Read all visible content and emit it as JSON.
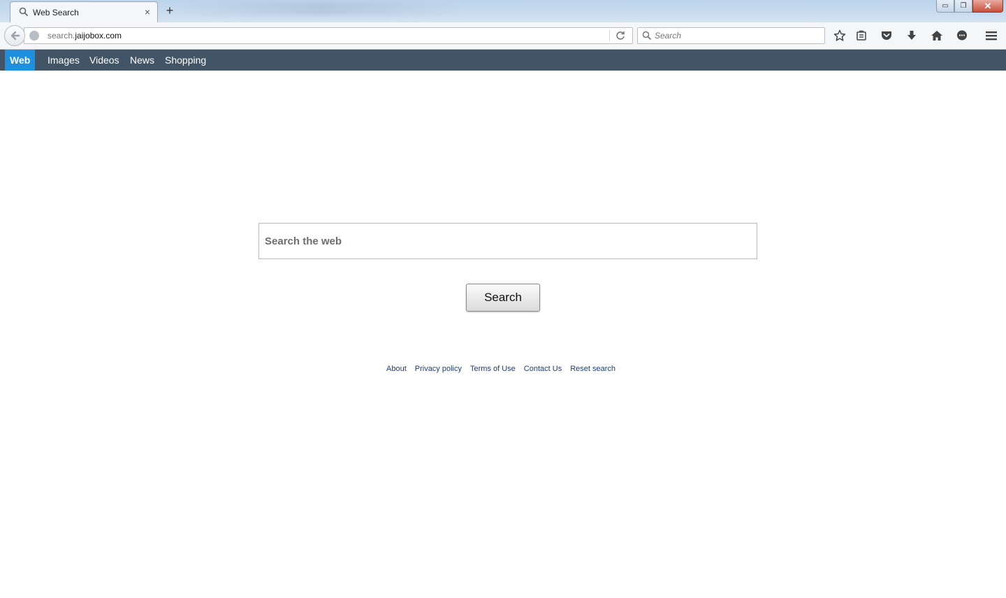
{
  "browser": {
    "tab": {
      "title": "Web Search",
      "close": "×"
    },
    "new_tab": "+",
    "window_controls": {
      "minimize": "▭",
      "restore": "❐",
      "close": "✕"
    },
    "url": {
      "prefix": "search.",
      "domain": "jaijobox.com"
    },
    "search_placeholder": "Search"
  },
  "site_nav": {
    "items": [
      {
        "label": "Web",
        "active": true
      },
      {
        "label": "Images",
        "active": false
      },
      {
        "label": "Videos",
        "active": false
      },
      {
        "label": "News",
        "active": false
      },
      {
        "label": "Shopping",
        "active": false
      }
    ]
  },
  "main": {
    "search_placeholder": "Search the web",
    "search_button": "Search"
  },
  "footer": {
    "links": [
      "About",
      "Privacy policy",
      "Terms of Use",
      "Contact Us",
      "Reset search"
    ]
  },
  "colors": {
    "nav_background": "#425567",
    "nav_active": "#1f8fe0",
    "link": "#1b3e7a"
  }
}
